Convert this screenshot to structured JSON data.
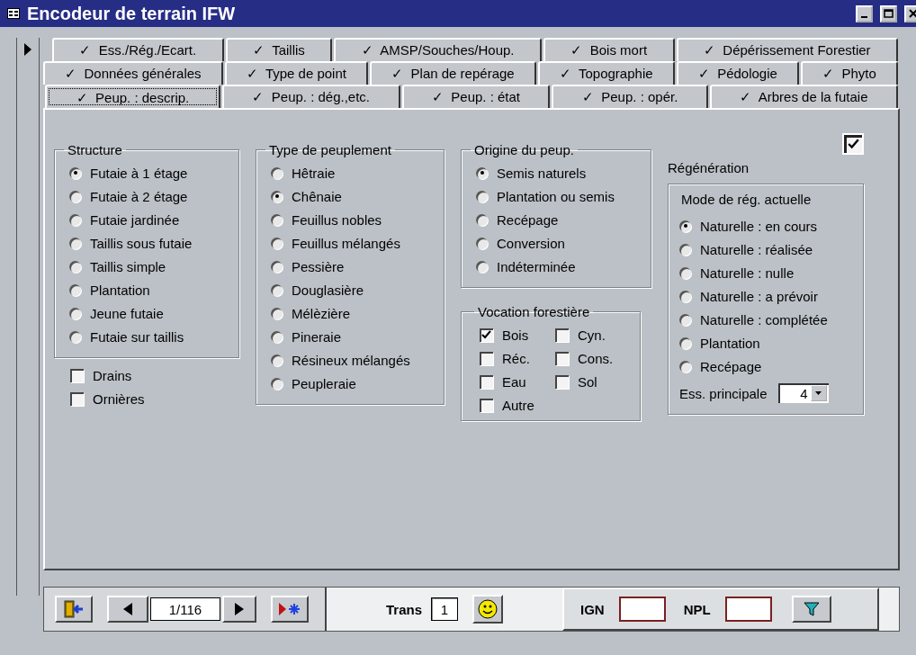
{
  "window": {
    "title": "Encodeur de terrain IFW"
  },
  "tab_rows": [
    [
      {
        "label": "✓  Ess./Rég./Ecart.",
        "selected": false
      },
      {
        "label": "✓  Taillis",
        "selected": false
      },
      {
        "label": "✓  AMSP/Souches/Houp.",
        "selected": false
      },
      {
        "label": "✓  Bois mort",
        "selected": false
      },
      {
        "label": "✓  Dépérissement Forestier",
        "selected": false
      }
    ],
    [
      {
        "label": "✓  Données générales",
        "selected": false
      },
      {
        "label": "✓  Type de point",
        "selected": false
      },
      {
        "label": "✓  Plan de repérage",
        "selected": false
      },
      {
        "label": "✓  Topographie",
        "selected": false
      },
      {
        "label": "✓  Pédologie",
        "selected": false
      },
      {
        "label": "✓  Phyto",
        "selected": false
      }
    ],
    [
      {
        "label": "✓  Peup. : descrip.",
        "selected": true
      },
      {
        "label": "✓  Peup. : dég.,etc.",
        "selected": false
      },
      {
        "label": "✓  Peup. : état",
        "selected": false
      },
      {
        "label": "✓  Peup. : opér.",
        "selected": false
      },
      {
        "label": "✓  Arbres de la futaie",
        "selected": false
      }
    ]
  ],
  "structure": {
    "title": "Structure",
    "options": [
      {
        "label": "Futaie à 1 étage",
        "selected": true
      },
      {
        "label": "Futaie à 2 étage",
        "selected": false
      },
      {
        "label": "Futaie jardinée",
        "selected": false
      },
      {
        "label": "Taillis sous futaie",
        "selected": false
      },
      {
        "label": "Taillis simple",
        "selected": false
      },
      {
        "label": "Plantation",
        "selected": false
      },
      {
        "label": "Jeune futaie",
        "selected": false
      },
      {
        "label": "Futaie sur taillis",
        "selected": false
      }
    ]
  },
  "structure_checks": [
    {
      "label": "Drains",
      "checked": false
    },
    {
      "label": "Ornières",
      "checked": false
    }
  ],
  "type_peuplement": {
    "title": "Type de peuplement",
    "options": [
      {
        "label": "Hêtraie",
        "selected": false
      },
      {
        "label": "Chênaie",
        "selected": true
      },
      {
        "label": "Feuillus nobles",
        "selected": false
      },
      {
        "label": "Feuillus mélangés",
        "selected": false
      },
      {
        "label": "Pessière",
        "selected": false
      },
      {
        "label": "Douglasière",
        "selected": false
      },
      {
        "label": "Mélèzière",
        "selected": false
      },
      {
        "label": "Pineraie",
        "selected": false
      },
      {
        "label": "Résineux mélangés",
        "selected": false
      },
      {
        "label": "Peupleraie",
        "selected": false
      }
    ]
  },
  "origine": {
    "title": "Origine du peup.",
    "options": [
      {
        "label": "Semis naturels",
        "selected": true
      },
      {
        "label": "Plantation ou semis",
        "selected": false
      },
      {
        "label": "Recépage",
        "selected": false
      },
      {
        "label": "Conversion",
        "selected": false
      },
      {
        "label": "Indéterminée",
        "selected": false
      }
    ]
  },
  "vocation": {
    "title": "Vocation forestière",
    "options": [
      {
        "label": "Bois",
        "checked": true
      },
      {
        "label": "Cyn.",
        "checked": false
      },
      {
        "label": "Réc.",
        "checked": false
      },
      {
        "label": "Cons.",
        "checked": false
      },
      {
        "label": "Eau",
        "checked": false
      },
      {
        "label": "Sol",
        "checked": false
      },
      {
        "label": "Autre",
        "checked": false
      }
    ]
  },
  "regeneration": {
    "title": "Régénération",
    "checked": true,
    "mode_title": "Mode de rég. actuelle",
    "options": [
      {
        "label": "Naturelle : en cours",
        "selected": true
      },
      {
        "label": "Naturelle : réalisée",
        "selected": false
      },
      {
        "label": "Naturelle : nulle",
        "selected": false
      },
      {
        "label": "Naturelle : a prévoir",
        "selected": false
      },
      {
        "label": "Naturelle : complétée",
        "selected": false
      },
      {
        "label": "Plantation",
        "selected": false
      },
      {
        "label": "Recépage",
        "selected": false
      }
    ],
    "ess_label": "Ess. principale",
    "ess_value": "4"
  },
  "footer": {
    "record": "1/116",
    "trans_label": "Trans",
    "trans_value": "1",
    "ign_label": "IGN",
    "npl_label": "NPL"
  }
}
